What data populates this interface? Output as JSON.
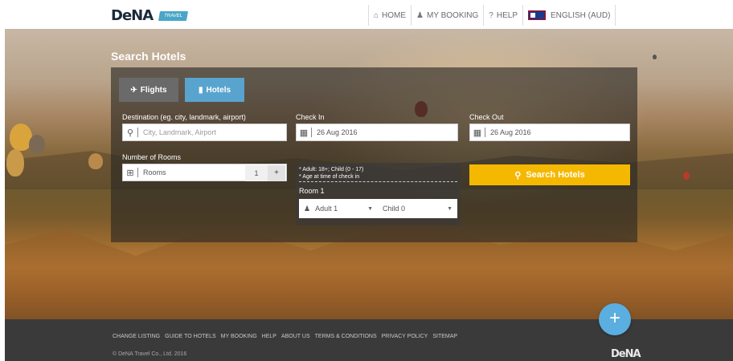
{
  "header": {
    "logo_text": "DeNA",
    "logo_tag": "TRAVEL",
    "nav": [
      {
        "icon": "home-icon",
        "glyph": "⌂",
        "label": "HOME"
      },
      {
        "icon": "user-icon",
        "glyph": "♟",
        "label": "MY BOOKING"
      },
      {
        "icon": "help-icon",
        "glyph": "?",
        "label": "HELP"
      },
      {
        "icon": "flag-icon",
        "glyph": "",
        "label": "ENGLISH (AUD)"
      }
    ]
  },
  "hero": {
    "title": "Search Hotels"
  },
  "tabs": {
    "flights": "Flights",
    "hotels": "Hotels"
  },
  "form": {
    "destination_label": "Destination (eg. city, landmark, airport)",
    "destination_placeholder": "City, Landmark, Airport",
    "checkin_label": "Check In",
    "checkin_value": "26 Aug 2016",
    "checkout_label": "Check Out",
    "checkout_value": "26 Aug 2016",
    "rooms_label": "Number of Rooms",
    "rooms_value": "Rooms",
    "rooms_count": "1",
    "guests_line1": "* Adult: 18+; Child (0 - 17)",
    "guests_line2": "* Age at time of check in",
    "room_title": "Room 1",
    "adult_value": "Adult 1",
    "child_value": "Child 0",
    "search_button": "Search Hotels"
  },
  "footer": {
    "links": [
      "CHANGE LISTING",
      "GUIDE TO HOTELS",
      "MY BOOKING",
      "HELP",
      "ABOUT US",
      "TERMS & CONDITIONS",
      "PRIVACY POLICY",
      "SITEMAP"
    ],
    "copyright": "© DeNA Travel Co., Ltd. 2016",
    "logo": "DeNA"
  },
  "fab_label": "+",
  "colors": {
    "accent_blue": "#58a4cf",
    "search_yellow": "#f5b800",
    "footer_bg": "#3a3a3a"
  }
}
